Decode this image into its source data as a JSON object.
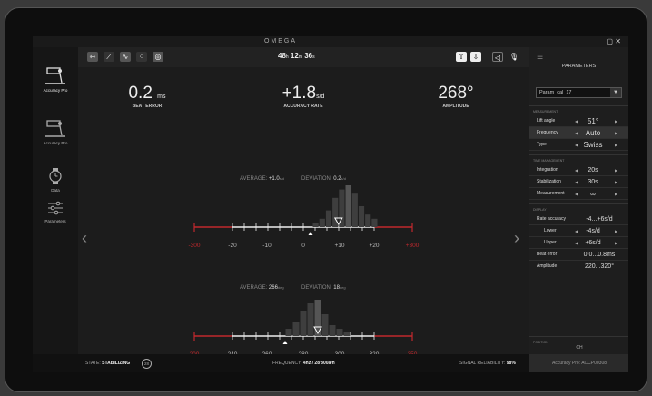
{
  "app": {
    "title": "OMEGA",
    "window_controls": "_ ▢ ✕"
  },
  "sidebar": {
    "items": [
      {
        "label": "Accuracy Pro",
        "icon": "timegrapher-icon"
      },
      {
        "label": "Accuracy Pro",
        "icon": "timegrapher-icon"
      },
      {
        "label": "Data",
        "icon": "watch-icon"
      },
      {
        "label": "Parameters",
        "icon": "sliders-icon"
      }
    ]
  },
  "toolbar": {
    "time": {
      "h": "48",
      "h_u": "h",
      "m": "12",
      "m_u": "m",
      "s": "36",
      "s_u": "s"
    }
  },
  "metrics": {
    "beat_error": {
      "value": "0.2",
      "unit": "ms",
      "label": "BEAT ERROR"
    },
    "accuracy_rate": {
      "value": "+1.8",
      "unit": "s/d",
      "label": "ACCURACY RATE"
    },
    "amplitude": {
      "value": "268°",
      "label": "AMPLITUDE"
    }
  },
  "chart_data": [
    {
      "type": "bar",
      "title": "",
      "average_label": "AVERAGE:",
      "average_value": "+1.0",
      "average_unit": "s/d",
      "deviation_label": "DEVIATION:",
      "deviation_value": "0.2",
      "deviation_unit": "s/d",
      "ticks": [
        "-300",
        "-20",
        "-10",
        "0",
        "+10",
        "+20",
        "+300"
      ],
      "x": [
        -6,
        -4,
        -2,
        0,
        2,
        4,
        6,
        8,
        10,
        12
      ],
      "values": [
        1,
        2,
        4,
        7,
        9,
        10,
        8,
        5,
        3,
        2
      ],
      "marker": 1.0
    },
    {
      "type": "bar",
      "title": "",
      "average_label": "AVERAGE:",
      "average_value": "266",
      "average_unit": "deg",
      "deviation_label": "DEVIATION:",
      "deviation_value": "18",
      "deviation_unit": "deg",
      "ticks": [
        "200",
        "240",
        "260",
        "280",
        "300",
        "320",
        "350"
      ],
      "x": [
        250,
        254,
        258,
        262,
        266,
        270,
        274,
        278,
        282
      ],
      "values": [
        2,
        4,
        7,
        9,
        10,
        6,
        3,
        2,
        1
      ],
      "marker": 266
    }
  ],
  "pager": "●●●●●",
  "status": {
    "state_label": "STATE:",
    "state_value": "STABILIZING",
    "state_count": "28",
    "freq_label": "FREQUENCY:",
    "freq_value": "4hz / 28'800a/h",
    "signal_label": "SIGNAL RELIABILITY:",
    "signal_value": "98%"
  },
  "parameters": {
    "title": "PARAMETERS",
    "profile": "Param_cal_17",
    "measurement_section": "MEASUREMENT",
    "rows1": [
      {
        "label": "Lift angle",
        "value": "51°"
      },
      {
        "label": "Frequency",
        "value": "Auto"
      },
      {
        "label": "Type",
        "value": "Swiss"
      }
    ],
    "time_section": "TIME MANAGEMENT",
    "rows2": [
      {
        "label": "Integration",
        "value": "20s"
      },
      {
        "label": "Stabilization",
        "value": "30s"
      },
      {
        "label": "Measurement",
        "value": "∞"
      }
    ],
    "display_section": "DISPLAY",
    "rows3": [
      {
        "label": "Rate accuracy",
        "value": "-4...+6s/d"
      },
      {
        "label": "Lower",
        "value": "-4s/d"
      },
      {
        "label": "Upper",
        "value": "+6s/d"
      },
      {
        "label": "Beat error",
        "value": "0.0...0.8ms"
      },
      {
        "label": "Amplitude",
        "value": "220...320°"
      }
    ],
    "position_section": "POSITION",
    "position_value": "CH",
    "footer": "Accuracy Pro: ACCP00308"
  }
}
